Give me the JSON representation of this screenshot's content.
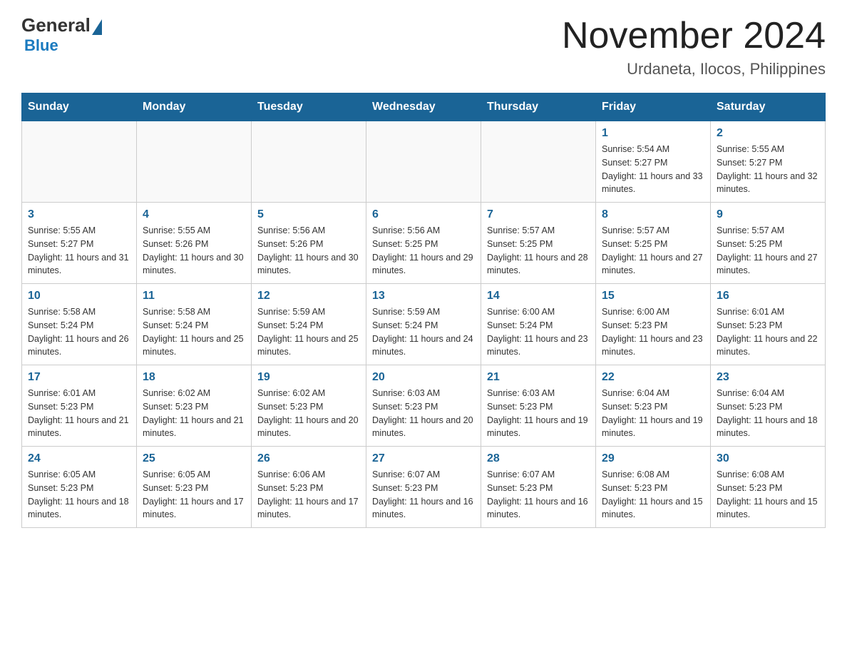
{
  "header": {
    "logo": {
      "general": "General",
      "blue": "Blue"
    },
    "title": "November 2024",
    "location": "Urdaneta, Ilocos, Philippines"
  },
  "weekdays": [
    "Sunday",
    "Monday",
    "Tuesday",
    "Wednesday",
    "Thursday",
    "Friday",
    "Saturday"
  ],
  "weeks": [
    [
      {
        "day": "",
        "info": ""
      },
      {
        "day": "",
        "info": ""
      },
      {
        "day": "",
        "info": ""
      },
      {
        "day": "",
        "info": ""
      },
      {
        "day": "",
        "info": ""
      },
      {
        "day": "1",
        "info": "Sunrise: 5:54 AM\nSunset: 5:27 PM\nDaylight: 11 hours and 33 minutes."
      },
      {
        "day": "2",
        "info": "Sunrise: 5:55 AM\nSunset: 5:27 PM\nDaylight: 11 hours and 32 minutes."
      }
    ],
    [
      {
        "day": "3",
        "info": "Sunrise: 5:55 AM\nSunset: 5:27 PM\nDaylight: 11 hours and 31 minutes."
      },
      {
        "day": "4",
        "info": "Sunrise: 5:55 AM\nSunset: 5:26 PM\nDaylight: 11 hours and 30 minutes."
      },
      {
        "day": "5",
        "info": "Sunrise: 5:56 AM\nSunset: 5:26 PM\nDaylight: 11 hours and 30 minutes."
      },
      {
        "day": "6",
        "info": "Sunrise: 5:56 AM\nSunset: 5:25 PM\nDaylight: 11 hours and 29 minutes."
      },
      {
        "day": "7",
        "info": "Sunrise: 5:57 AM\nSunset: 5:25 PM\nDaylight: 11 hours and 28 minutes."
      },
      {
        "day": "8",
        "info": "Sunrise: 5:57 AM\nSunset: 5:25 PM\nDaylight: 11 hours and 27 minutes."
      },
      {
        "day": "9",
        "info": "Sunrise: 5:57 AM\nSunset: 5:25 PM\nDaylight: 11 hours and 27 minutes."
      }
    ],
    [
      {
        "day": "10",
        "info": "Sunrise: 5:58 AM\nSunset: 5:24 PM\nDaylight: 11 hours and 26 minutes."
      },
      {
        "day": "11",
        "info": "Sunrise: 5:58 AM\nSunset: 5:24 PM\nDaylight: 11 hours and 25 minutes."
      },
      {
        "day": "12",
        "info": "Sunrise: 5:59 AM\nSunset: 5:24 PM\nDaylight: 11 hours and 25 minutes."
      },
      {
        "day": "13",
        "info": "Sunrise: 5:59 AM\nSunset: 5:24 PM\nDaylight: 11 hours and 24 minutes."
      },
      {
        "day": "14",
        "info": "Sunrise: 6:00 AM\nSunset: 5:24 PM\nDaylight: 11 hours and 23 minutes."
      },
      {
        "day": "15",
        "info": "Sunrise: 6:00 AM\nSunset: 5:23 PM\nDaylight: 11 hours and 23 minutes."
      },
      {
        "day": "16",
        "info": "Sunrise: 6:01 AM\nSunset: 5:23 PM\nDaylight: 11 hours and 22 minutes."
      }
    ],
    [
      {
        "day": "17",
        "info": "Sunrise: 6:01 AM\nSunset: 5:23 PM\nDaylight: 11 hours and 21 minutes."
      },
      {
        "day": "18",
        "info": "Sunrise: 6:02 AM\nSunset: 5:23 PM\nDaylight: 11 hours and 21 minutes."
      },
      {
        "day": "19",
        "info": "Sunrise: 6:02 AM\nSunset: 5:23 PM\nDaylight: 11 hours and 20 minutes."
      },
      {
        "day": "20",
        "info": "Sunrise: 6:03 AM\nSunset: 5:23 PM\nDaylight: 11 hours and 20 minutes."
      },
      {
        "day": "21",
        "info": "Sunrise: 6:03 AM\nSunset: 5:23 PM\nDaylight: 11 hours and 19 minutes."
      },
      {
        "day": "22",
        "info": "Sunrise: 6:04 AM\nSunset: 5:23 PM\nDaylight: 11 hours and 19 minutes."
      },
      {
        "day": "23",
        "info": "Sunrise: 6:04 AM\nSunset: 5:23 PM\nDaylight: 11 hours and 18 minutes."
      }
    ],
    [
      {
        "day": "24",
        "info": "Sunrise: 6:05 AM\nSunset: 5:23 PM\nDaylight: 11 hours and 18 minutes."
      },
      {
        "day": "25",
        "info": "Sunrise: 6:05 AM\nSunset: 5:23 PM\nDaylight: 11 hours and 17 minutes."
      },
      {
        "day": "26",
        "info": "Sunrise: 6:06 AM\nSunset: 5:23 PM\nDaylight: 11 hours and 17 minutes."
      },
      {
        "day": "27",
        "info": "Sunrise: 6:07 AM\nSunset: 5:23 PM\nDaylight: 11 hours and 16 minutes."
      },
      {
        "day": "28",
        "info": "Sunrise: 6:07 AM\nSunset: 5:23 PM\nDaylight: 11 hours and 16 minutes."
      },
      {
        "day": "29",
        "info": "Sunrise: 6:08 AM\nSunset: 5:23 PM\nDaylight: 11 hours and 15 minutes."
      },
      {
        "day": "30",
        "info": "Sunrise: 6:08 AM\nSunset: 5:23 PM\nDaylight: 11 hours and 15 minutes."
      }
    ]
  ]
}
